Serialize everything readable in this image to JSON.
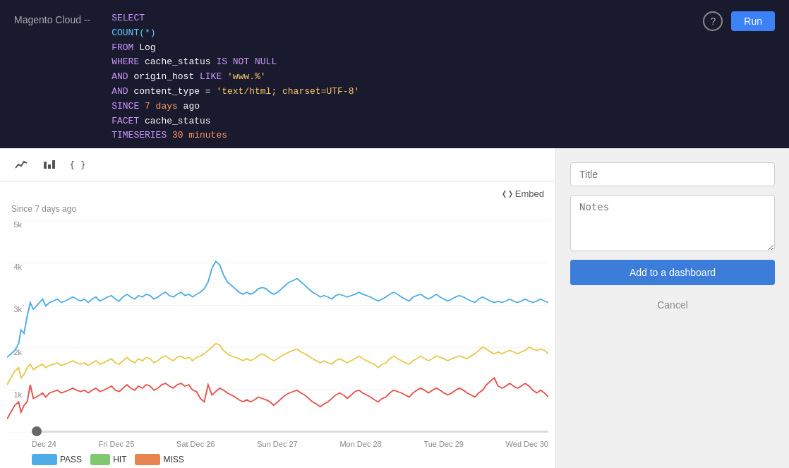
{
  "topbar": {
    "title": "Magento Cloud --",
    "run_label": "Run",
    "help_icon": "?",
    "sql_lines": [
      {
        "type": "code",
        "parts": [
          {
            "cls": "kw",
            "t": "SELECT"
          }
        ]
      },
      {
        "type": "code",
        "parts": [
          {
            "cls": "plain",
            "t": "     "
          },
          {
            "cls": "fn",
            "t": "COUNT(*)"
          }
        ]
      },
      {
        "type": "code",
        "parts": [
          {
            "cls": "kw",
            "t": "FROM"
          },
          {
            "cls": "plain",
            "t": " Log"
          }
        ]
      },
      {
        "type": "code",
        "parts": [
          {
            "cls": "kw",
            "t": "WHERE"
          },
          {
            "cls": "plain",
            "t": " cache_status "
          },
          {
            "cls": "kw",
            "t": "IS NOT NULL"
          }
        ]
      },
      {
        "type": "code",
        "parts": [
          {
            "cls": "plain",
            "t": "     "
          },
          {
            "cls": "kw",
            "t": "AND"
          },
          {
            "cls": "plain",
            "t": " origin_host "
          },
          {
            "cls": "kw",
            "t": "LIKE"
          },
          {
            "cls": "plain",
            "t": " "
          },
          {
            "cls": "str",
            "t": "'www.%'"
          }
        ]
      },
      {
        "type": "code",
        "parts": [
          {
            "cls": "plain",
            "t": "     "
          },
          {
            "cls": "kw",
            "t": "AND"
          },
          {
            "cls": "plain",
            "t": " content_type "
          },
          {
            "cls": "plain",
            "t": "= "
          },
          {
            "cls": "str",
            "t": "'text/html; charset=UTF-8'"
          }
        ]
      },
      {
        "type": "code",
        "parts": [
          {
            "cls": "kw",
            "t": "SINCE"
          },
          {
            "cls": "plain",
            "t": " "
          },
          {
            "cls": "num",
            "t": "7 days"
          },
          {
            "cls": "plain",
            "t": " ago"
          }
        ]
      },
      {
        "type": "code",
        "parts": [
          {
            "cls": "kw",
            "t": "FACET"
          },
          {
            "cls": "plain",
            "t": " cache_status"
          }
        ]
      },
      {
        "type": "code",
        "parts": [
          {
            "cls": "kw",
            "t": "TIMESERIES"
          },
          {
            "cls": "plain",
            "t": " "
          },
          {
            "cls": "num",
            "t": "30 minutes"
          }
        ]
      }
    ]
  },
  "toolbar": {
    "line_chart_icon": "∿",
    "bar_chart_icon": "▲",
    "code_icon": "{}"
  },
  "chart": {
    "embed_label": "Embed",
    "since_label": "Since 7 days ago",
    "y_labels": [
      "5k",
      "4k",
      "3k",
      "2k",
      "1k",
      ""
    ],
    "x_labels": [
      "Dec 24",
      "Fri Dec 25",
      "Sat Dec 26",
      "Sun Dec 27",
      "Mon Dec 28",
      "Tue Dec 29",
      "Wed Dec 30"
    ],
    "legend": [
      {
        "label": "PASS",
        "color": "#4dade8"
      },
      {
        "label": "HIT",
        "color": "#7ec96e"
      },
      {
        "label": "MISS",
        "color": "#e8834d"
      }
    ]
  },
  "sidebar": {
    "title_placeholder": "Title",
    "notes_placeholder": "Notes",
    "add_dashboard_label": "Add to a dashboard",
    "cancel_label": "Cancel"
  }
}
